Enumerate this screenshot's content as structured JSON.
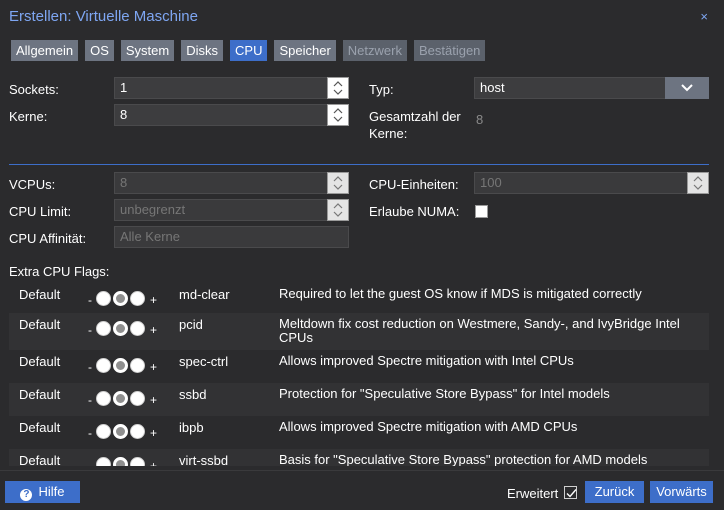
{
  "window": {
    "title": "Erstellen: Virtuelle Maschine",
    "close_label": "×"
  },
  "tabs": [
    {
      "label": "Allgemein",
      "state": "normal"
    },
    {
      "label": "OS",
      "state": "normal"
    },
    {
      "label": "System",
      "state": "normal"
    },
    {
      "label": "Disks",
      "state": "normal"
    },
    {
      "label": "CPU",
      "state": "active"
    },
    {
      "label": "Speicher",
      "state": "normal"
    },
    {
      "label": "Netzwerk",
      "state": "disabled"
    },
    {
      "label": "Bestätigen",
      "state": "disabled"
    }
  ],
  "cpu": {
    "sockets_label": "Sockets:",
    "sockets_value": "1",
    "cores_label": "Kerne:",
    "cores_value": "8",
    "type_label": "Typ:",
    "type_value": "host",
    "total_cores_label_1": "Gesamtzahl der",
    "total_cores_label_2": "Kerne:",
    "total_cores_value": "8",
    "vcpus_label": "VCPUs:",
    "vcpus_placeholder": "8",
    "cpu_units_label": "CPU-Einheiten:",
    "cpu_units_placeholder": "100",
    "cpu_limit_label": "CPU Limit:",
    "cpu_limit_placeholder": "unbegrenzt",
    "numa_label": "Erlaube NUMA:",
    "affinity_label": "CPU Affinität:",
    "affinity_placeholder": "Alle Kerne"
  },
  "flags": {
    "section_label": "Extra CPU Flags:",
    "minus": "-",
    "plus": "+",
    "rows": [
      {
        "state": "Default",
        "flag": "md-clear",
        "desc": "Required to let the guest OS know if MDS is mitigated correctly"
      },
      {
        "state": "Default",
        "flag": "pcid",
        "desc": "Meltdown fix cost reduction on Westmere, Sandy-, and IvyBridge Intel CPUs"
      },
      {
        "state": "Default",
        "flag": "spec-ctrl",
        "desc": "Allows improved Spectre mitigation with Intel CPUs"
      },
      {
        "state": "Default",
        "flag": "ssbd",
        "desc": "Protection for \"Speculative Store Bypass\" for Intel models"
      },
      {
        "state": "Default",
        "flag": "ibpb",
        "desc": "Allows improved Spectre mitigation with AMD CPUs"
      },
      {
        "state": "Default",
        "flag": "virt-ssbd",
        "desc": "Basis for \"Speculative Store Bypass\" protection for AMD models"
      }
    ]
  },
  "footer": {
    "help_label": "Hilfe",
    "help_icon": "?",
    "advanced_label": "Erweitert",
    "advanced_checked": true,
    "back_label": "Zurück",
    "next_label": "Vorwärts"
  },
  "colors": {
    "accent": "#3d6ec9",
    "title": "#7ea6f2",
    "background": "#2b2b2d"
  }
}
